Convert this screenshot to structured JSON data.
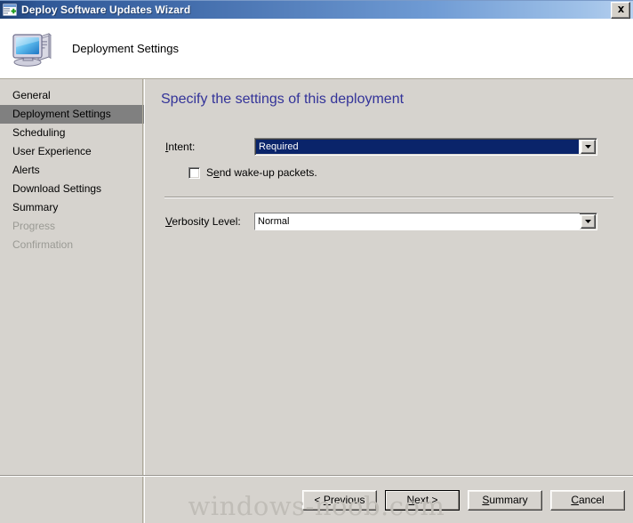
{
  "window": {
    "title": "Deploy Software Updates Wizard",
    "titlebar_icon": "wizard-window-icon",
    "close_label": "✕",
    "close_icon": "close-icon",
    "accent_titlebar_dark": "#1c3e72",
    "accent_titlebar_light": "#b6d0ef"
  },
  "header": {
    "title": "Deployment Settings",
    "icon": "computer-monitor-icon"
  },
  "sidebar": {
    "items": [
      {
        "label": "General",
        "state": "normal"
      },
      {
        "label": "Deployment Settings",
        "state": "selected"
      },
      {
        "label": "Scheduling",
        "state": "normal"
      },
      {
        "label": "User Experience",
        "state": "normal"
      },
      {
        "label": "Alerts",
        "state": "normal"
      },
      {
        "label": "Download Settings",
        "state": "normal"
      },
      {
        "label": "Summary",
        "state": "normal"
      },
      {
        "label": "Progress",
        "state": "disabled"
      },
      {
        "label": "Confirmation",
        "state": "disabled"
      }
    ],
    "selected_index": 1,
    "selected_bg": "#808080"
  },
  "main": {
    "page_title": "Specify the settings of this deployment",
    "page_title_color": "#333399",
    "intent": {
      "label_prefix": "",
      "label_accel": "I",
      "label_suffix": "ntent:",
      "value": "Required",
      "focused": true,
      "arrow_icon": "chevron-down-icon"
    },
    "wake_up": {
      "label_prefix": "S",
      "label_accel": "e",
      "label_suffix": "nd wake-up packets.",
      "checked": false
    },
    "verbosity": {
      "label_prefix": "",
      "label_accel": "V",
      "label_suffix": "erbosity Level:",
      "value": "Normal",
      "focused": false,
      "arrow_icon": "chevron-down-icon"
    }
  },
  "footer": {
    "buttons": [
      {
        "prefix": "< ",
        "accel": "P",
        "suffix": "revious",
        "name": "previous-button",
        "default": false
      },
      {
        "prefix": "",
        "accel": "N",
        "suffix": "ext >",
        "name": "next-button",
        "default": true
      },
      {
        "prefix": "",
        "accel": "S",
        "suffix": "ummary",
        "name": "summary-button",
        "default": false
      },
      {
        "prefix": "",
        "accel": "C",
        "suffix": "ancel",
        "name": "cancel-button",
        "default": false
      }
    ]
  },
  "watermark": {
    "text": "windows-noob.com",
    "color": "#c0bdb7"
  }
}
